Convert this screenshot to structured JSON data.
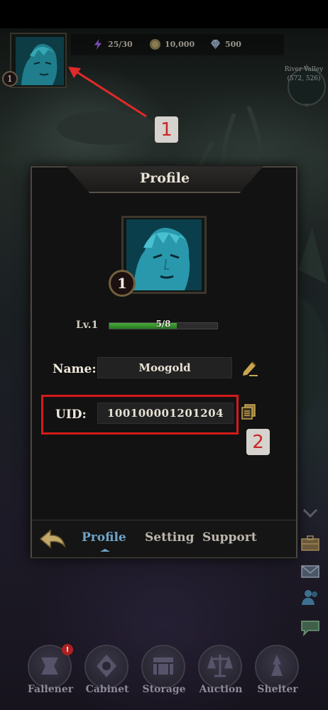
{
  "top_bar": {
    "player_level": "1",
    "stamina": "25/30",
    "gold": "10,000",
    "gems": "500"
  },
  "map": {
    "location_name": "River Valley",
    "coordinates": "(572, 526)"
  },
  "annotations": {
    "marker_1": "1",
    "marker_2": "2",
    "highlight_color": "#d51a1a"
  },
  "profile_dialog": {
    "title": "Profile",
    "level_badge": "1",
    "level_label": "Lv.1",
    "exp_text": "5/8",
    "exp_fraction": 0.625,
    "name_label": "Name:",
    "name_value": "Moogold",
    "uid_label": "UID:",
    "uid_value": "100100001201204",
    "tabs": [
      {
        "label": "Profile",
        "active": true
      },
      {
        "label": "Setting",
        "active": false
      },
      {
        "label": "Support",
        "active": false
      }
    ],
    "active_tab_color": "#6fa3c9"
  },
  "side_icons": [
    "briefcase-icon",
    "mail-icon",
    "friends-icon",
    "chat-icon"
  ],
  "bottom_nav": [
    {
      "label": "Fallener",
      "alert": "!"
    },
    {
      "label": "Cabinet"
    },
    {
      "label": "Storage"
    },
    {
      "label": "Auction"
    },
    {
      "label": "Shelter"
    }
  ]
}
